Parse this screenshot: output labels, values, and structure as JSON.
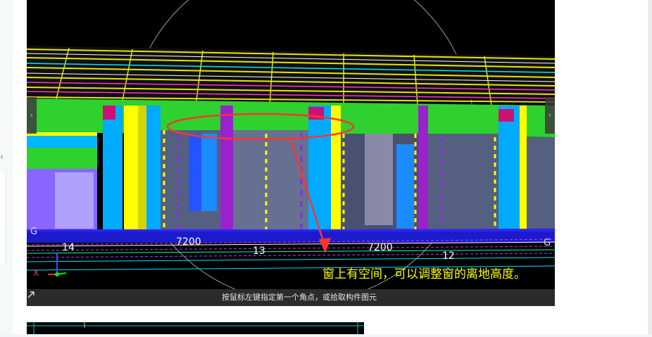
{
  "viewport": {
    "dimensions": [
      "7200",
      "7200"
    ],
    "axis_numbers": [
      "14",
      "13",
      "12"
    ],
    "grid_letters": [
      "G",
      "G"
    ],
    "axis_x_label": "X"
  },
  "caption": "窗上有空间，可以调整窗的离地高度。",
  "statusbar": {
    "hint": "按鼠标左键指定第一个角点，或拾取构件图元"
  },
  "toolbar": {
    "buttons": [
      "view-cube-icon",
      "dropdown-icon",
      "fullscreen-icon",
      "3d-box-icon",
      "settings-list-icon"
    ]
  },
  "colors": {
    "annotation": "#ff3333",
    "caption_text": "#ffff00"
  }
}
